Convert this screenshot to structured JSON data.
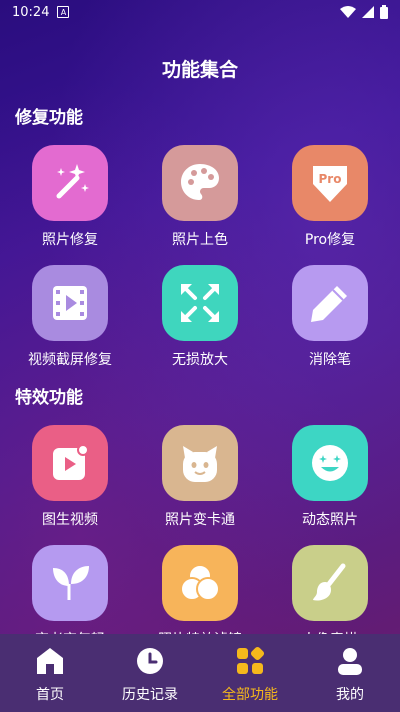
{
  "status_bar": {
    "time": "10:24",
    "sim_letter": "A"
  },
  "page_title": "功能集合",
  "sections": [
    {
      "title": "修复功能",
      "items": [
        {
          "label": "照片修复",
          "icon": "magic-wand-icon",
          "color": "#e36bd0"
        },
        {
          "label": "照片上色",
          "icon": "palette-icon",
          "color": "#d59a9a"
        },
        {
          "label": "Pro修复",
          "icon": "pro-badge-icon",
          "badge_text": "Pro",
          "color": "#e88868"
        },
        {
          "label": "视频截屏修复",
          "icon": "film-icon",
          "color": "#a98be0"
        },
        {
          "label": "无损放大",
          "icon": "expand-arrows-icon",
          "color": "#3fd6be"
        },
        {
          "label": "消除笔",
          "icon": "pencil-icon",
          "color": "#b79af0"
        }
      ]
    },
    {
      "title": "特效功能",
      "items": [
        {
          "label": "图生视频",
          "icon": "play-image-icon",
          "color": "#ea5f86"
        },
        {
          "label": "照片变卡通",
          "icon": "cartoon-face-icon",
          "color": "#d9b690"
        },
        {
          "label": "动态照片",
          "icon": "smile-face-icon",
          "color": "#3dd6c4"
        },
        {
          "label": "变老变年轻",
          "icon": "sprout-icon",
          "color": "#b59af0"
        },
        {
          "label": "照片特效滤镜",
          "icon": "filter-circles-icon",
          "color": "#f7b45a"
        },
        {
          "label": "人像素描",
          "icon": "brush-icon",
          "color": "#c9cf8a"
        }
      ]
    }
  ],
  "bottom_nav": [
    {
      "label": "首页",
      "icon": "home-icon"
    },
    {
      "label": "历史记录",
      "icon": "clock-icon"
    },
    {
      "label": "全部功能",
      "icon": "grid-icon",
      "active": true
    },
    {
      "label": "我的",
      "icon": "user-icon"
    }
  ],
  "colors": {
    "nav_bg": "#4a2e72",
    "nav_active": "#f5b81c"
  }
}
